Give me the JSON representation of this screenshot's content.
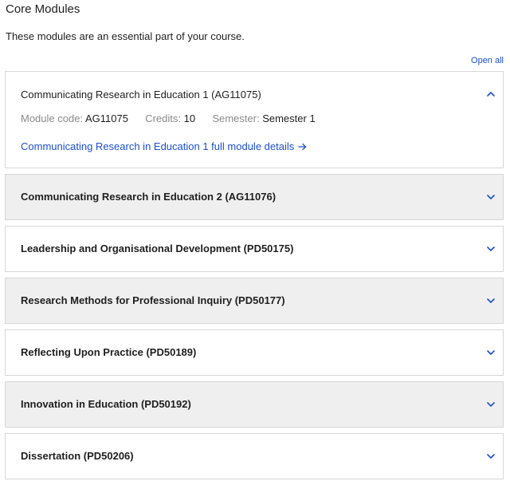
{
  "section": {
    "title": "Core Modules",
    "intro": "These modules are an essential part of your course.",
    "open_all": "Open all"
  },
  "modules": [
    {
      "title": "Communicating Research in Education 1 (AG11075)",
      "expanded": true,
      "code_label": "Module code:",
      "code": "AG11075",
      "credits_label": "Credits:",
      "credits": "10",
      "semester_label": "Semester:",
      "semester": "Semester 1",
      "details_link": "Communicating Research in Education 1 full module details"
    },
    {
      "title": "Communicating Research in Education 2 (AG11076)",
      "expanded": false
    },
    {
      "title": "Leadership and Organisational Development (PD50175)",
      "expanded": false
    },
    {
      "title": "Research Methods for Professional Inquiry (PD50177)",
      "expanded": false
    },
    {
      "title": "Reflecting Upon Practice (PD50189)",
      "expanded": false
    },
    {
      "title": "Innovation in Education (PD50192)",
      "expanded": false
    },
    {
      "title": "Dissertation (PD50206)",
      "expanded": false
    }
  ],
  "icons": {
    "expanded": "chevron-up-icon",
    "collapsed": "chevron-down-icon",
    "link_arrow": "arrow-right-icon"
  },
  "colors": {
    "link": "#1c4fd1",
    "shaded_row": "#efefef",
    "border": "#d7d7d7",
    "muted_label": "#8a8a8a"
  }
}
